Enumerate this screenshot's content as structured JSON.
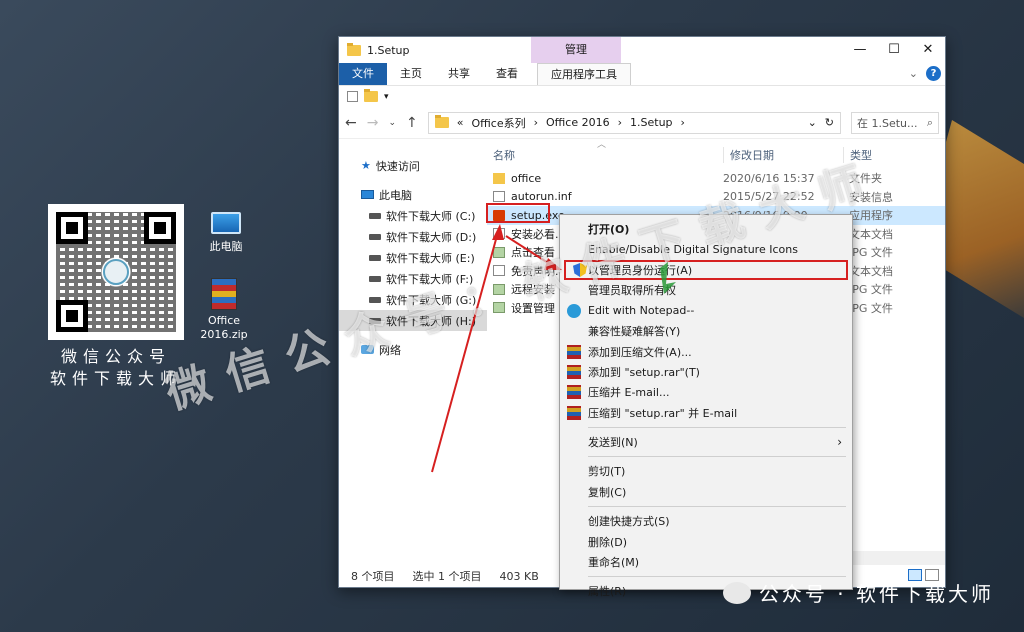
{
  "desktop": {
    "qr_caption_line1": "微信公众号",
    "qr_caption_line2": "软件下载大师",
    "icons": [
      {
        "label": "此电脑",
        "icon": "computer-icon"
      },
      {
        "label": "Office\n2016.zip",
        "icon": "winrar-archive-icon"
      }
    ],
    "watermark": "微信公众号：软件下载大师",
    "credit": "公众号 · 软件下载大师"
  },
  "window": {
    "title": "1.Setup",
    "manage_tab": "管理",
    "ribbon_tabs": [
      "文件",
      "主页",
      "共享",
      "查看",
      "应用程序工具"
    ],
    "address": {
      "prefix": "«",
      "crumbs": [
        "Office系列",
        "Office 2016",
        "1.Setup"
      ]
    },
    "search_placeholder": "在 1.Setu...",
    "nav": [
      {
        "label": "快速访问",
        "icon": "star-icon"
      },
      {
        "label": "此电脑",
        "icon": "pc-icon"
      },
      {
        "label": "软件下载大师 (C:)",
        "icon": "drive-icon"
      },
      {
        "label": "软件下载大师 (D:)",
        "icon": "drive-icon"
      },
      {
        "label": "软件下载大师 (E:)",
        "icon": "drive-icon"
      },
      {
        "label": "软件下载大师 (F:)",
        "icon": "drive-icon"
      },
      {
        "label": "软件下载大师 (G:)",
        "icon": "drive-icon"
      },
      {
        "label": "软件下载大师 (H:)",
        "icon": "drive-icon"
      },
      {
        "label": "网络",
        "icon": "network-icon"
      }
    ],
    "columns": {
      "name": "名称",
      "date": "修改日期",
      "type": "类型"
    },
    "files": [
      {
        "name": "office",
        "date": "2020/6/16 15:37",
        "type": "文件夹",
        "icon": "folder"
      },
      {
        "name": "autorun.inf",
        "date": "2015/5/27 22:52",
        "type": "安装信息",
        "icon": "doc"
      },
      {
        "name": "setup.exe",
        "date": "2016/9/16 9:00",
        "type": "应用程序",
        "icon": "office"
      },
      {
        "name": "安装必看.",
        "date": "",
        "type": "文本文档",
        "icon": "doc"
      },
      {
        "name": "点击查看",
        "date": "",
        "type": "JPG 文件",
        "icon": "img"
      },
      {
        "name": "免责声明.",
        "date": "",
        "type": "文本文档",
        "icon": "doc"
      },
      {
        "name": "远程安装",
        "date": "",
        "type": "JPG 文件",
        "icon": "img"
      },
      {
        "name": "设置管理",
        "date": "",
        "type": "JPG 文件",
        "icon": "img"
      }
    ],
    "status": {
      "count": "8 个项目",
      "selected": "选中 1 个项目",
      "size": "403 KB"
    }
  },
  "context_menu": {
    "items": [
      {
        "label": "打开(O)",
        "bold": true,
        "icon": ""
      },
      {
        "label": "Enable/Disable Digital Signature Icons",
        "icon": ""
      },
      {
        "label": "以管理员身份运行(A)",
        "icon": "shield",
        "highlight": true
      },
      {
        "label": "管理员取得所有权",
        "icon": ""
      },
      {
        "label": "Edit with Notepad--",
        "icon": "notepad"
      },
      {
        "label": "兼容性疑难解答(Y)",
        "icon": ""
      },
      {
        "label": "添加到压缩文件(A)...",
        "icon": "rar"
      },
      {
        "label": "添加到 \"setup.rar\"(T)",
        "icon": "rar"
      },
      {
        "label": "压缩并 E-mail...",
        "icon": "rar"
      },
      {
        "label": "压缩到 \"setup.rar\" 并 E-mail",
        "icon": "rar",
        "sep_after": true
      },
      {
        "label": "发送到(N)",
        "icon": "",
        "submenu": true,
        "sep_after": true
      },
      {
        "label": "剪切(T)",
        "icon": ""
      },
      {
        "label": "复制(C)",
        "icon": "",
        "sep_after": true
      },
      {
        "label": "创建快捷方式(S)",
        "icon": ""
      },
      {
        "label": "删除(D)",
        "icon": ""
      },
      {
        "label": "重命名(M)",
        "icon": "",
        "sep_after": true
      },
      {
        "label": "属性(R)",
        "icon": ""
      }
    ]
  },
  "colors": {
    "accent": "#1c5fa8",
    "highlight_red": "#d62020",
    "selection": "#cce8ff",
    "manage_tab": "#e6cfee"
  }
}
